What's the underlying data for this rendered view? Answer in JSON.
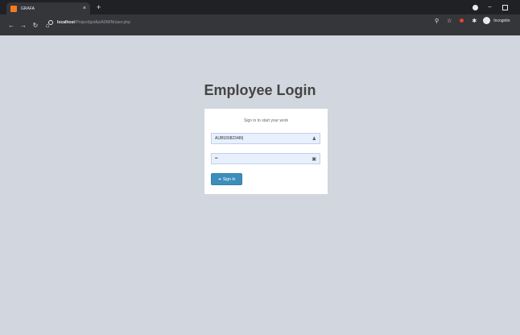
{
  "browser": {
    "tab_title": "GRAFA",
    "tab_close": "×",
    "new_tab": "+",
    "minimize": "−",
    "url_host": "localhost",
    "url_path": "/Project/grafia/ADMIN/user.php",
    "incognito_label": "Incognito"
  },
  "login": {
    "title": "Employee Login",
    "message": "Sign in to start your work",
    "username_value": "AUB93082348I|",
    "password_value": "••",
    "signin_label": "Sign In"
  }
}
